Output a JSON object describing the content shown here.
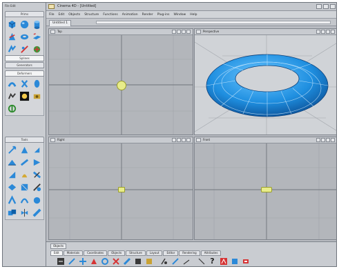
{
  "app": {
    "window_title": "Cinema 4D - [Untitled]",
    "menu": [
      "File",
      "Edit",
      "Objects",
      "Structure",
      "Functions",
      "Animation",
      "Render",
      "Plug-ins",
      "Window",
      "Help"
    ],
    "document_tab": "Untitled 1",
    "left_top_label": "File  Edit"
  },
  "left_panel": {
    "groups": [
      {
        "label": "Prims",
        "tools": [
          "cube",
          "sphere",
          "cylinder",
          "cone",
          "torus",
          "plane",
          "figure",
          "tube",
          "landscape"
        ]
      },
      {
        "label": "Splines",
        "tools": []
      },
      {
        "label": "Generators",
        "tools": []
      },
      {
        "label": "Deformers",
        "tools": [
          "bend",
          "twist",
          "bulge",
          "scene",
          "light",
          "camera",
          "null"
        ]
      },
      {
        "label": "Tools",
        "tools": [
          "move",
          "scale",
          "rotate",
          "extrude",
          "knife",
          "bevel",
          "bridge",
          "brush",
          "magnet",
          "mirror",
          "weld",
          "smooth"
        ]
      }
    ]
  },
  "viewports": [
    {
      "label": "Top",
      "mode": "flat"
    },
    {
      "label": "Perspective",
      "mode": "shaded"
    },
    {
      "label": "Right",
      "mode": "flat"
    },
    {
      "label": "Front",
      "mode": "flat"
    }
  ],
  "viewport_menu": "View  Cameras  Display  Filter  Panel",
  "bottom_bar": {
    "section_label": "Objects",
    "tabs": [
      "Edit",
      "Materials",
      "Coordinates",
      "Objects",
      "Structure",
      "Layout",
      "Editor",
      "Rendering",
      "Attributes"
    ],
    "active_tab": "Edit",
    "tools": [
      "undo",
      "live-select",
      "move",
      "scale",
      "rotate",
      "x-axis",
      "y-axis",
      "z-axis",
      "world",
      "model",
      "object",
      "point",
      "polygon",
      "help",
      "render-view",
      "render-picture",
      "render-settings"
    ]
  },
  "colors": {
    "torus": "#1f8fe0",
    "gizmo": "#e8ec8a",
    "viewport_bg": "#b3b6bb"
  }
}
